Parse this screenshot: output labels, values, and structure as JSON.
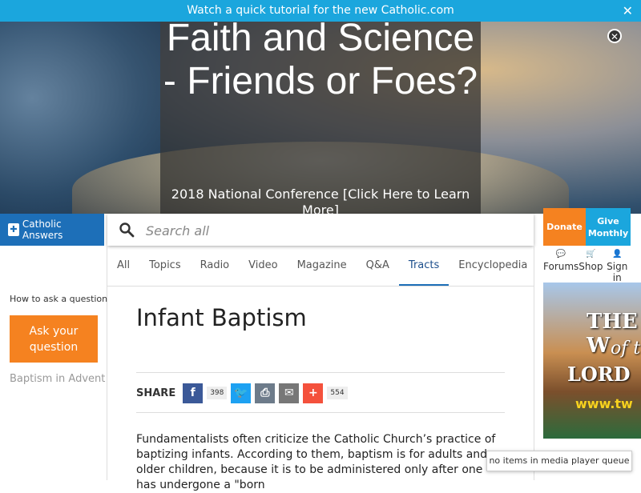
{
  "topbar": {
    "text": "Watch a quick tutorial for the new Catholic.com",
    "close": "✕"
  },
  "banner": {
    "title": "Faith and Science - Friends or Foes?",
    "subtitle": "2018 National Conference [Click Here to Learn More]",
    "close": "✕"
  },
  "header": {
    "logo": "Catholic Answers",
    "search_placeholder": "Search all",
    "donate": "Donate",
    "give_monthly": "Give Monthly"
  },
  "nav": {
    "tabs": [
      {
        "label": "All"
      },
      {
        "label": "Topics"
      },
      {
        "label": "Radio"
      },
      {
        "label": "Video"
      },
      {
        "label": "Magazine"
      },
      {
        "label": "Q&A"
      },
      {
        "label": "Tracts"
      },
      {
        "label": "Encyclopedia"
      }
    ],
    "active": "Tracts"
  },
  "utilities": [
    {
      "label": "Forums",
      "icon": "chat-icon"
    },
    {
      "label": "Shop",
      "icon": "cart-icon"
    },
    {
      "label": "Sign in",
      "icon": "user-icon"
    }
  ],
  "sidebar": {
    "howto": "How to ask a question",
    "ask_button": "Ask your question",
    "related": "Baptism in Advent"
  },
  "article": {
    "title": "Infant Baptism",
    "share_label": "SHARE",
    "facebook_count": "398",
    "addthis_count": "554",
    "body": "Fundamentalists often criticize the Catholic Church’s practice of baptizing infants. According to them, baptism is for adults and older children, because it is to be administered only after one has undergone a \"born"
  },
  "ad": {
    "line1": "THE W",
    "line2": "of t",
    "line3": "LORD",
    "line4": "www.tw"
  },
  "media_player": {
    "text": "no items in media player queue"
  },
  "colors": {
    "accent_blue": "#1ba6dd",
    "logo_blue": "#1d6fb8",
    "orange": "#f58220"
  }
}
